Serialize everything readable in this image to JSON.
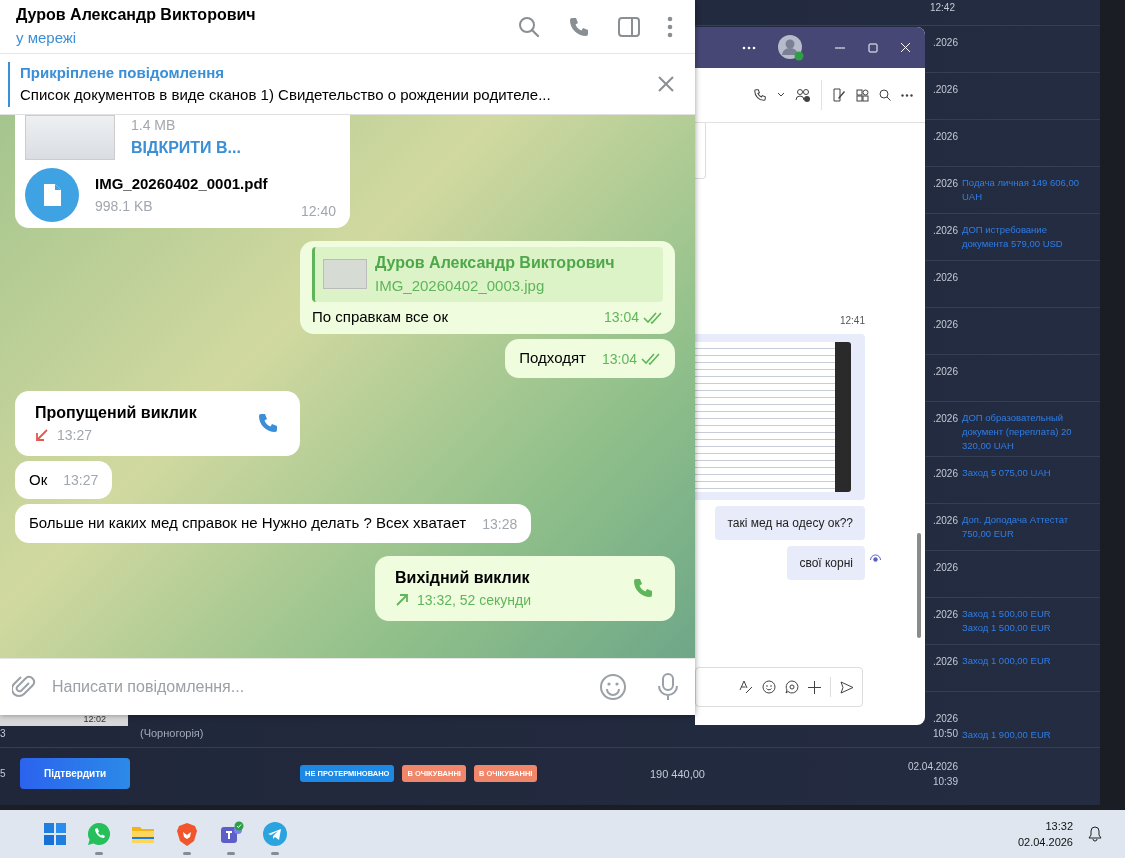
{
  "background_app": {
    "top_time": "12:42",
    "left_time": "12:02",
    "rows": [
      {
        "date": ".2026"
      },
      {
        "date": ".2026"
      },
      {
        "date": ".2026"
      },
      {
        "date": ".2026",
        "notes": [
          "Подача личная 149 606,00 UAH"
        ]
      },
      {
        "date": ".2026",
        "notes": [
          "ДОП истребование документа 579,00 USD"
        ]
      },
      {
        "date": ".2026"
      },
      {
        "date": ".2026"
      },
      {
        "date": ".2026"
      },
      {
        "date": ".2026",
        "notes": [
          "ДОП образовательный документ (переплата) 20 320,00 UAH"
        ]
      },
      {
        "date": ".2026",
        "notes": [
          "Заход 5 075,00 UAH"
        ]
      },
      {
        "date": ".2026",
        "notes": [
          "Доп. Доподача Аттестат 750,00 EUR"
        ]
      },
      {
        "date": ".2026"
      },
      {
        "date": ".2026",
        "notes": [
          "Заход 1 500,00 EUR",
          "Заход 1 500,00 EUR"
        ]
      },
      {
        "date": ".2026",
        "notes": [
          "Заход 1 000,00 EUR"
        ]
      },
      {
        "number": "3",
        "location": "(Чорногорія)",
        "date": ".2026",
        "time": "10:50",
        "notes": [
          "Заход 1 900,00 EUR"
        ]
      },
      {
        "number": "5",
        "action": "Підтвердити",
        "statuses": [
          {
            "text": "НЕ ПРОТЕРМІНОВАНО",
            "color": "#1e88e5"
          },
          {
            "text": "В ОЧІКУВАННІ",
            "color": "#f0866a"
          },
          {
            "text": "В ОЧІКУВАННІ",
            "color": "#f0866a"
          }
        ],
        "amount": "190 440,00",
        "date": "02.04.2026",
        "time": "10:39"
      }
    ]
  },
  "telegram": {
    "contact_name": "Дуров Александр Викторович",
    "contact_status": "у мережі",
    "pinned": {
      "title": "Прикріплене повідомлення",
      "text": "Список документов в виде сканов  1) Свидетельство о рождении родителе..."
    },
    "messages": [
      {
        "kind": "files",
        "outgoing": false,
        "time": "12:40",
        "doc_size": "1.4 MB",
        "doc_action": "ВІДКРИТИ В...",
        "file_name": "IMG_20260402_0001.pdf",
        "file_size": "998.1 KB"
      },
      {
        "kind": "reply",
        "outgoing": true,
        "read": true,
        "time": "13:04",
        "reply_author": "Дуров Александр Викторович",
        "reply_text": "IMG_20260402_0003.jpg",
        "text": "По справкам все ок"
      },
      {
        "kind": "text",
        "outgoing": true,
        "read": true,
        "time": "13:04",
        "text": "Подходят"
      },
      {
        "kind": "call",
        "outgoing": false,
        "missed": true,
        "title": "Пропущений виклик",
        "time": "13:27"
      },
      {
        "kind": "text",
        "outgoing": false,
        "time": "13:27",
        "text": "Ок"
      },
      {
        "kind": "text",
        "outgoing": false,
        "time": "13:28",
        "text": "Больше ни каких мед справок не Нужно делать ? Всех хватает"
      },
      {
        "kind": "call",
        "outgoing": true,
        "missed": false,
        "title": "Вихідний виклик",
        "time": "13:32, 52 секунди"
      }
    ],
    "composer": {
      "placeholder": "Написати повідомлення..."
    }
  },
  "teams": {
    "time_label": "12:41",
    "seen": true,
    "messages": [
      {
        "kind": "image"
      },
      {
        "kind": "text",
        "text": "такі мед на одесу ок??"
      },
      {
        "kind": "text",
        "text": "свої корні"
      }
    ]
  },
  "taskbar": {
    "apps": [
      {
        "kind": "start",
        "running": false
      },
      {
        "kind": "chat",
        "running": true
      },
      {
        "kind": "folder",
        "running": false
      },
      {
        "kind": "browser",
        "running": true
      },
      {
        "kind": "meeting",
        "running": true
      },
      {
        "kind": "messenger",
        "running": true
      }
    ],
    "time": "13:32",
    "date": "02.04.2026"
  }
}
